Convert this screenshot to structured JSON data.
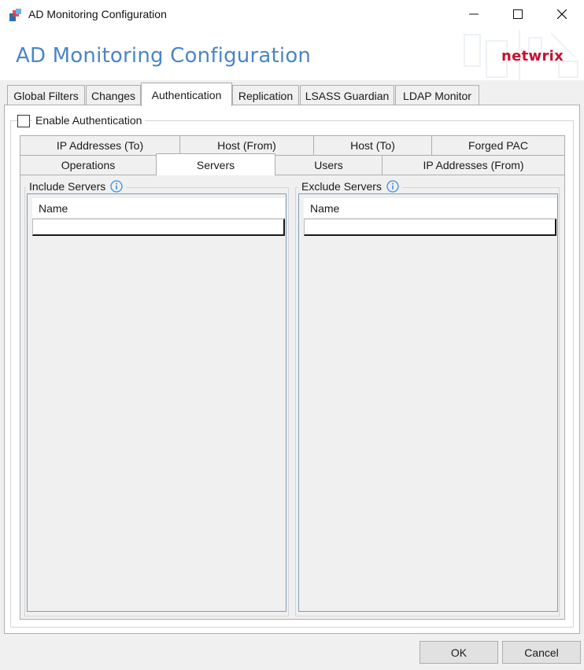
{
  "window": {
    "title": "AD Monitoring Configuration",
    "controls": [
      "minimize-icon",
      "maximize-icon",
      "close-icon"
    ]
  },
  "banner": {
    "title": "AD Monitoring Configuration",
    "brand": "netwrix",
    "title_color": "#4a86c8",
    "brand_color": "#c8102e"
  },
  "tabs": [
    {
      "label": "Global Filters",
      "active": false
    },
    {
      "label": "Changes",
      "active": false
    },
    {
      "label": "Authentication",
      "active": true
    },
    {
      "label": "Replication",
      "active": false
    },
    {
      "label": "LSASS Guardian",
      "active": false
    },
    {
      "label": "LDAP Monitor",
      "active": false
    }
  ],
  "authentication": {
    "enable_label": "Enable Authentication",
    "enabled": false,
    "subtabs_row1": [
      {
        "label": "IP Addresses (To)"
      },
      {
        "label": "Host (From)"
      },
      {
        "label": "Host (To)"
      },
      {
        "label": "Forged PAC"
      }
    ],
    "subtabs_row2": [
      {
        "label": "Operations",
        "active": false
      },
      {
        "label": "Servers",
        "active": true
      },
      {
        "label": "Users",
        "active": false
      },
      {
        "label": "IP Addresses (From)",
        "active": false
      }
    ],
    "include": {
      "label": "Include Servers",
      "column": "Name",
      "rows": [
        ""
      ]
    },
    "exclude": {
      "label": "Exclude Servers",
      "column": "Name",
      "rows": [
        ""
      ]
    }
  },
  "buttons": {
    "ok": "OK",
    "cancel": "Cancel"
  }
}
